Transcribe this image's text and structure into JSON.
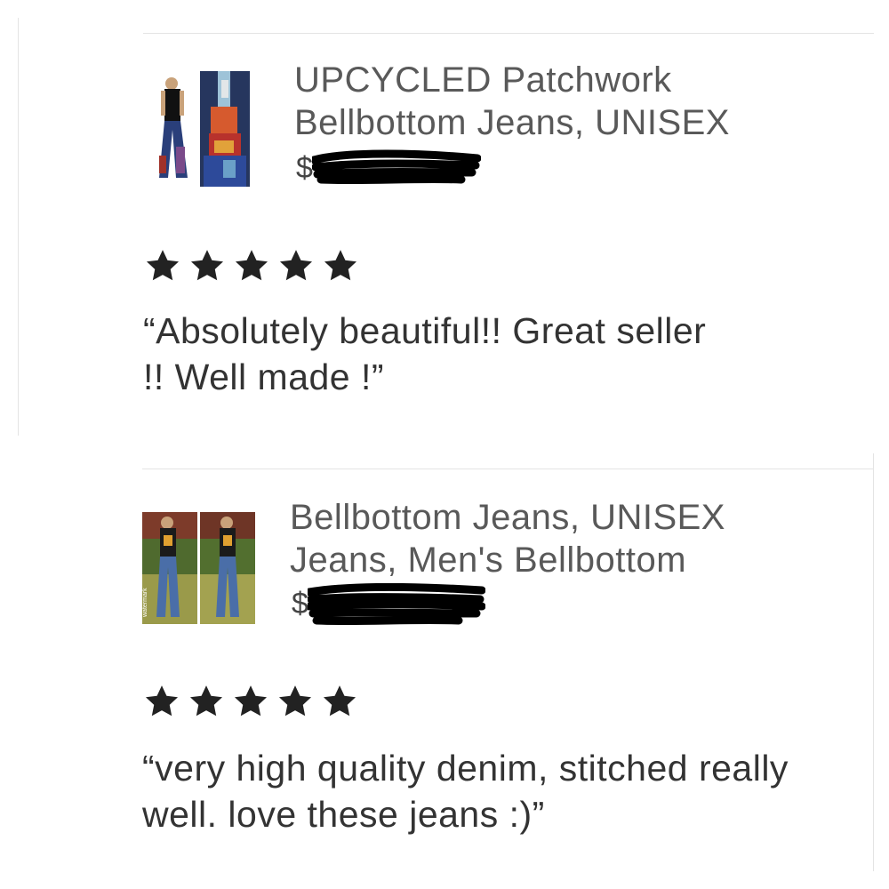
{
  "reviews": [
    {
      "product_title": "UPCYCLED Patchwork\nBellbottom Jeans, UNISEX",
      "price_prefix": "$",
      "price_redacted": true,
      "rating": 5,
      "review_text": "“Absolutely beautiful!! Great seller !! Well made !”"
    },
    {
      "product_title": "Bellbottom Jeans, UNISEX\nJeans, Men's Bellbottom",
      "price_prefix": "$",
      "price_redacted": true,
      "rating": 5,
      "review_text": "“very high quality denim, stitched really well. love these jeans :)”"
    }
  ],
  "colors": {
    "star": "#222222",
    "title_text": "#595959",
    "divider": "#e4e4e4",
    "redaction": "#000000"
  },
  "icons": [
    "star-icon"
  ]
}
